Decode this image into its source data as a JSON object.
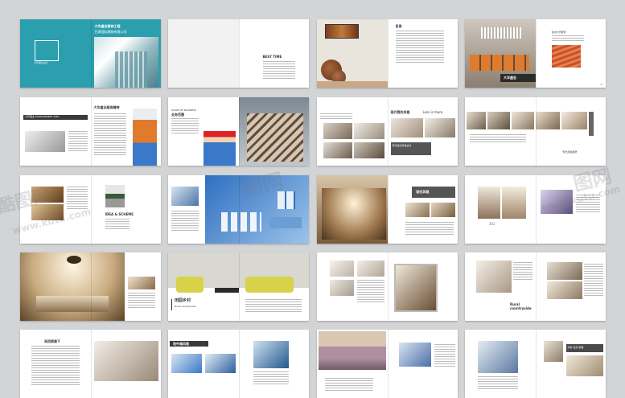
{
  "spreads": [
    {
      "id": "r1c1",
      "texts": {
        "cover_title": "大华盛业装饰工程",
        "cover_sub": "甘肃国际建筑有限公司",
        "logo_text": "大华盛业设计"
      }
    },
    {
      "id": "r1c2",
      "texts": {
        "best_time": "BEST TIME"
      }
    },
    {
      "id": "r1c3",
      "texts": {
        "toc": "目录"
      }
    },
    {
      "id": "r1c4",
      "texts": {
        "heading": "甘肃大华装饰",
        "caption": "大华盛业"
      }
    },
    {
      "id": "r2c1",
      "texts": {
        "title": "大华盛业服务精神",
        "banner": "大华盛业 MANAGEMENT IDEA"
      }
    },
    {
      "id": "r2c2",
      "texts": {
        "scope": "SCOPE OF BUSINESS",
        "scope_cn": "业务范围"
      }
    },
    {
      "id": "r2c3",
      "texts": {
        "title": "现代简约风格",
        "title_en": "Less is more",
        "box": "现代简约风格设计"
      }
    },
    {
      "id": "r2c4",
      "texts": {
        "caption": "现代风格装修"
      }
    },
    {
      "id": "r3c1",
      "texts": {
        "idea": "IDEA & SCHEME"
      }
    },
    {
      "id": "r3c2",
      "texts": {}
    },
    {
      "id": "r3c3",
      "texts": {
        "title": "欧式风格"
      }
    },
    {
      "id": "r3c4",
      "texts": {
        "number": "302"
      }
    },
    {
      "id": "r4c1",
      "texts": {}
    },
    {
      "id": "r4c2",
      "texts": {
        "title": "田园乡村",
        "sub": "Rural countryside"
      }
    },
    {
      "id": "r4c3",
      "texts": {}
    },
    {
      "id": "r4c4",
      "texts": {
        "title": "Rural",
        "title2": "countryside"
      }
    },
    {
      "id": "r5c1",
      "texts": {
        "title": "采用原装下"
      }
    },
    {
      "id": "r5c2",
      "texts": {
        "title": "地中海风格"
      }
    },
    {
      "id": "r5c3",
      "texts": {}
    },
    {
      "id": "r5c4",
      "texts": {
        "tags": "清新 自然 素雅"
      }
    }
  ],
  "watermarks": [
    "酷图网",
    "www.kutu.com",
    "图网",
    "www.kutu.com",
    "图网"
  ],
  "colors": {
    "teal": "#2b9fae",
    "orange": "#e07b2e",
    "blue": "#3a78c9",
    "background": "#d3d4d6",
    "dark": "#3a3a3a"
  }
}
